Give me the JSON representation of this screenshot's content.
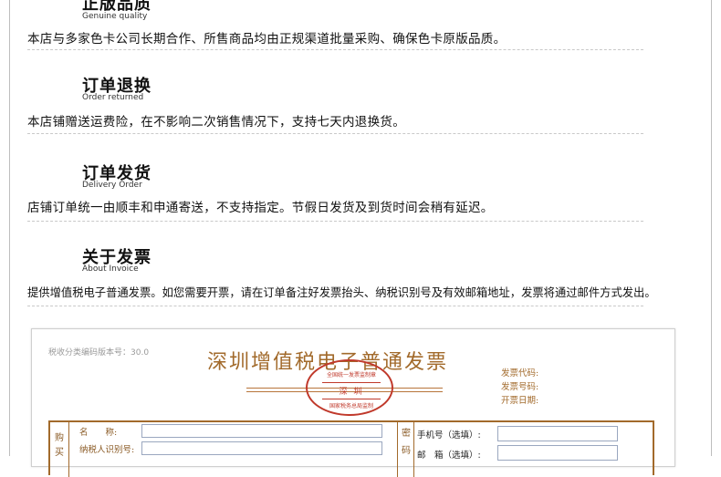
{
  "sections": [
    {
      "title": "正版品质",
      "subtitle": "Genuine quality",
      "body": "本店与多家色卡公司长期合作、所售商品均由正规渠道批量采购、确保色卡原版品质。"
    },
    {
      "title": "订单退换",
      "subtitle": "Order returned",
      "body": "本店铺赠送运费险，在不影响二次销售情况下，支持七天内退换货。"
    },
    {
      "title": "订单发货",
      "subtitle": "Delivery Order",
      "body": "店铺订单统一由顺丰和申通寄送，不支持指定。节假日发货及到货时间会稍有延迟。"
    },
    {
      "title": "关于发票",
      "subtitle": "About Invoice",
      "body": "提供增值税电子普通发票。如您需要开票，请在订单备注好发票抬头、纳税识别号及有效邮箱地址，发票将通过邮件方式发出。"
    }
  ],
  "invoice": {
    "code_version": "税收分类编码版本号：30.0",
    "title": "深圳增值税电子普通发票",
    "seal": {
      "top": "全国统一发票监制章",
      "middle": "深 圳",
      "bottom": "国家税务总局监制"
    },
    "meta": [
      "发票代码:",
      "发票号码:",
      "开票日期:"
    ],
    "buyer_label": [
      "购",
      "买"
    ],
    "fields": {
      "name": "名　　称:",
      "tax_id": "纳税人识别号:"
    },
    "cipher_label": [
      "密",
      "码"
    ],
    "right_fields": {
      "phone": "手机号（选填）:",
      "email": "邮　箱（选填）:"
    }
  }
}
